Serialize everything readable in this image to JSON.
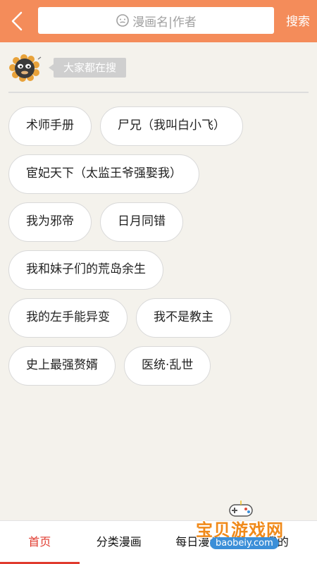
{
  "header": {
    "search_placeholder": "漫画名|作者",
    "search_button": "搜索",
    "back_icon": "chevron-left-icon",
    "background_color": "#f48c5a"
  },
  "hot": {
    "label": "大家都在搜",
    "tags": [
      [
        "术师手册",
        "尸兄（我叫白小飞）"
      ],
      [
        "宦妃天下（太监王爷强娶我）"
      ],
      [
        "我为邪帝",
        "日月同错"
      ],
      [
        "我和妹子们的荒岛余生"
      ],
      [
        "我的左手能异变",
        "我不是教主"
      ],
      [
        "史上最强赘婿",
        "医统·乱世"
      ]
    ]
  },
  "nav": {
    "items": [
      "首页",
      "分类漫画",
      "每日漫画",
      "我的"
    ],
    "active_index": 0,
    "active_color": "#e03a2e"
  },
  "watermark": {
    "title": "宝贝游戏网",
    "url": "baobeiy.com"
  }
}
